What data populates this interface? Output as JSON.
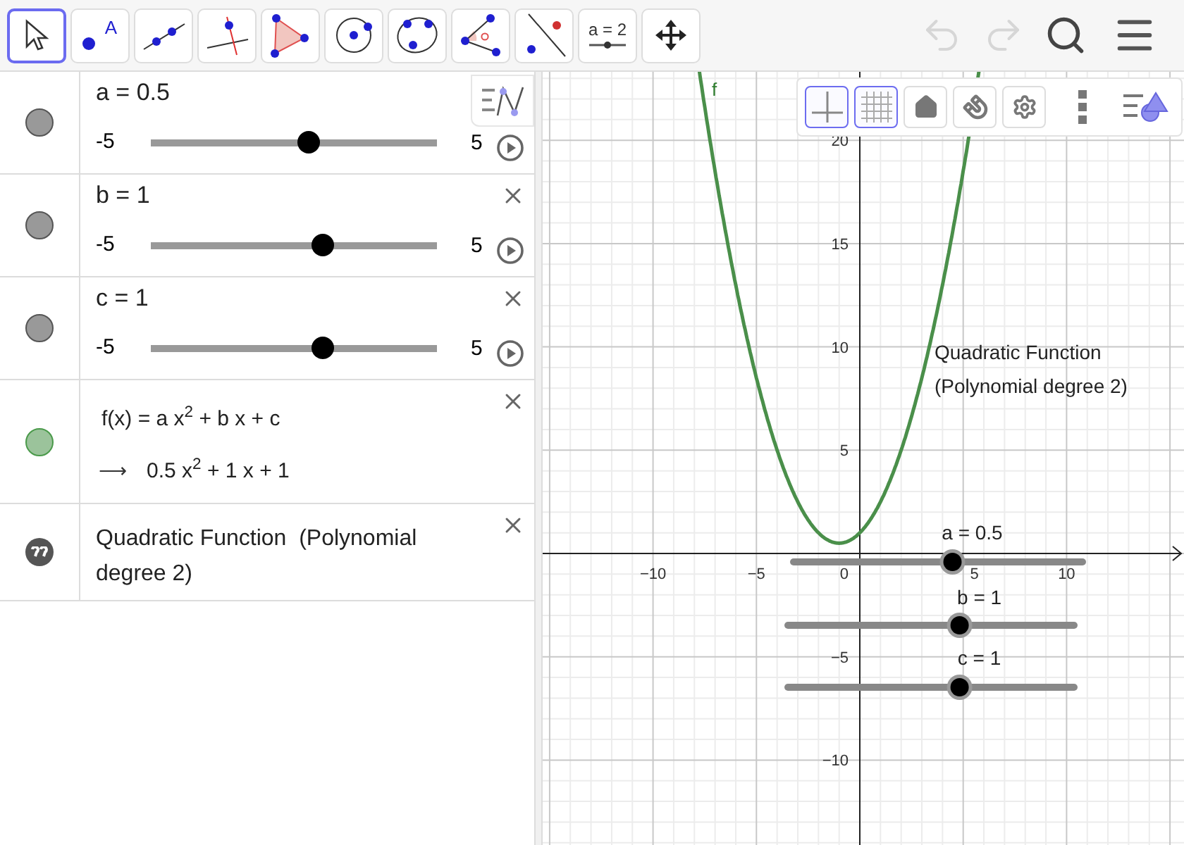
{
  "toolbar": {
    "tools": [
      {
        "kind": "move",
        "selected": true
      },
      {
        "kind": "point",
        "label": "A",
        "selected": false
      },
      {
        "kind": "line",
        "selected": false
      },
      {
        "kind": "perpendicular",
        "selected": false
      },
      {
        "kind": "polygon",
        "selected": false
      },
      {
        "kind": "circle",
        "selected": false
      },
      {
        "kind": "conic",
        "selected": false
      },
      {
        "kind": "angle",
        "selected": false
      },
      {
        "kind": "reflect",
        "selected": false
      },
      {
        "kind": "slider",
        "label": "a = 2",
        "selected": false
      },
      {
        "kind": "move-view",
        "selected": false
      }
    ],
    "undo": {
      "disabled": true
    },
    "redo": {
      "disabled": true
    }
  },
  "algebra": {
    "rows": [
      {
        "kind": "slider",
        "color": "#999999",
        "label": "a = 0.5",
        "min": "-5",
        "max": "5",
        "level": 0.55,
        "closable": false
      },
      {
        "kind": "slider",
        "color": "#999999",
        "label": "b = 1",
        "min": "-5",
        "max": "5",
        "level": 0.6,
        "closable": true
      },
      {
        "kind": "slider",
        "color": "#999999",
        "label": "c = 1",
        "min": "-5",
        "max": "5",
        "level": 0.6,
        "closable": true
      },
      {
        "kind": "function",
        "color": "#9bc39b",
        "definition": "f(x) = a x$^{2}$ + b x + c",
        "arrow": "⟶",
        "value": "0.5 x$^{2}$ + 1 x + 1",
        "closable": true
      },
      {
        "kind": "text",
        "color": "#555555",
        "text": "Quadratic Function  (Polynomial degree 2)",
        "closable": true
      }
    ]
  },
  "graphics": {
    "style_bar": [
      {
        "kind": "axes",
        "on": true
      },
      {
        "kind": "grid",
        "on": true
      },
      {
        "kind": "home",
        "on": false
      },
      {
        "kind": "magnet",
        "on": false
      },
      {
        "kind": "settings",
        "on": false
      },
      {
        "kind": "more"
      },
      {
        "kind": "style"
      }
    ],
    "function_label": "f",
    "x_ticks": [
      "−10",
      "−5",
      "0",
      "5",
      "10"
    ],
    "y_ticks": [
      "20",
      "15",
      "10",
      "5",
      "−5",
      "−10"
    ],
    "texts": [
      "Quadratic Function",
      "(Polynomial degree 2)"
    ],
    "sliders": [
      {
        "label": "a = 0.5",
        "level": 0.55
      },
      {
        "label": "b = 1",
        "level": 0.6
      },
      {
        "label": "c = 1",
        "level": 0.6
      }
    ]
  }
}
